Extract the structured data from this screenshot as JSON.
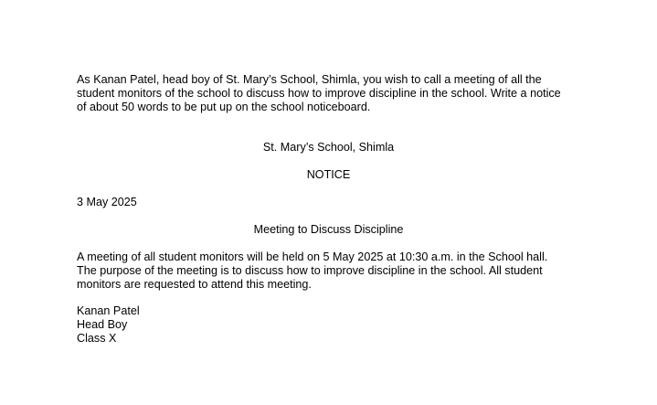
{
  "question": {
    "lines": [
      "As Kanan Patel, head boy of St. Mary’s School, Shimla, you wish to call a meeting of all the",
      "student monitors of the school to discuss how to improve discipline in the school. Write a notice",
      "of about 50 words to be put up on the school noticeboard."
    ]
  },
  "notice": {
    "school": "St. Mary’s School, Shimla",
    "heading": "NOTICE",
    "date": "3 May 2025",
    "subject": "Meeting to Discuss Discipline",
    "body_lines": [
      "A meeting of all student monitors will be held on 5 May 2025 at 10:30 a.m. in the School hall.",
      "The purpose of the meeting is to discuss how to improve discipline in the school. All student",
      "monitors are requested to attend this meeting."
    ],
    "signature": {
      "name": "Kanan Patel",
      "designation": "Head Boy",
      "class": "Class X"
    }
  }
}
